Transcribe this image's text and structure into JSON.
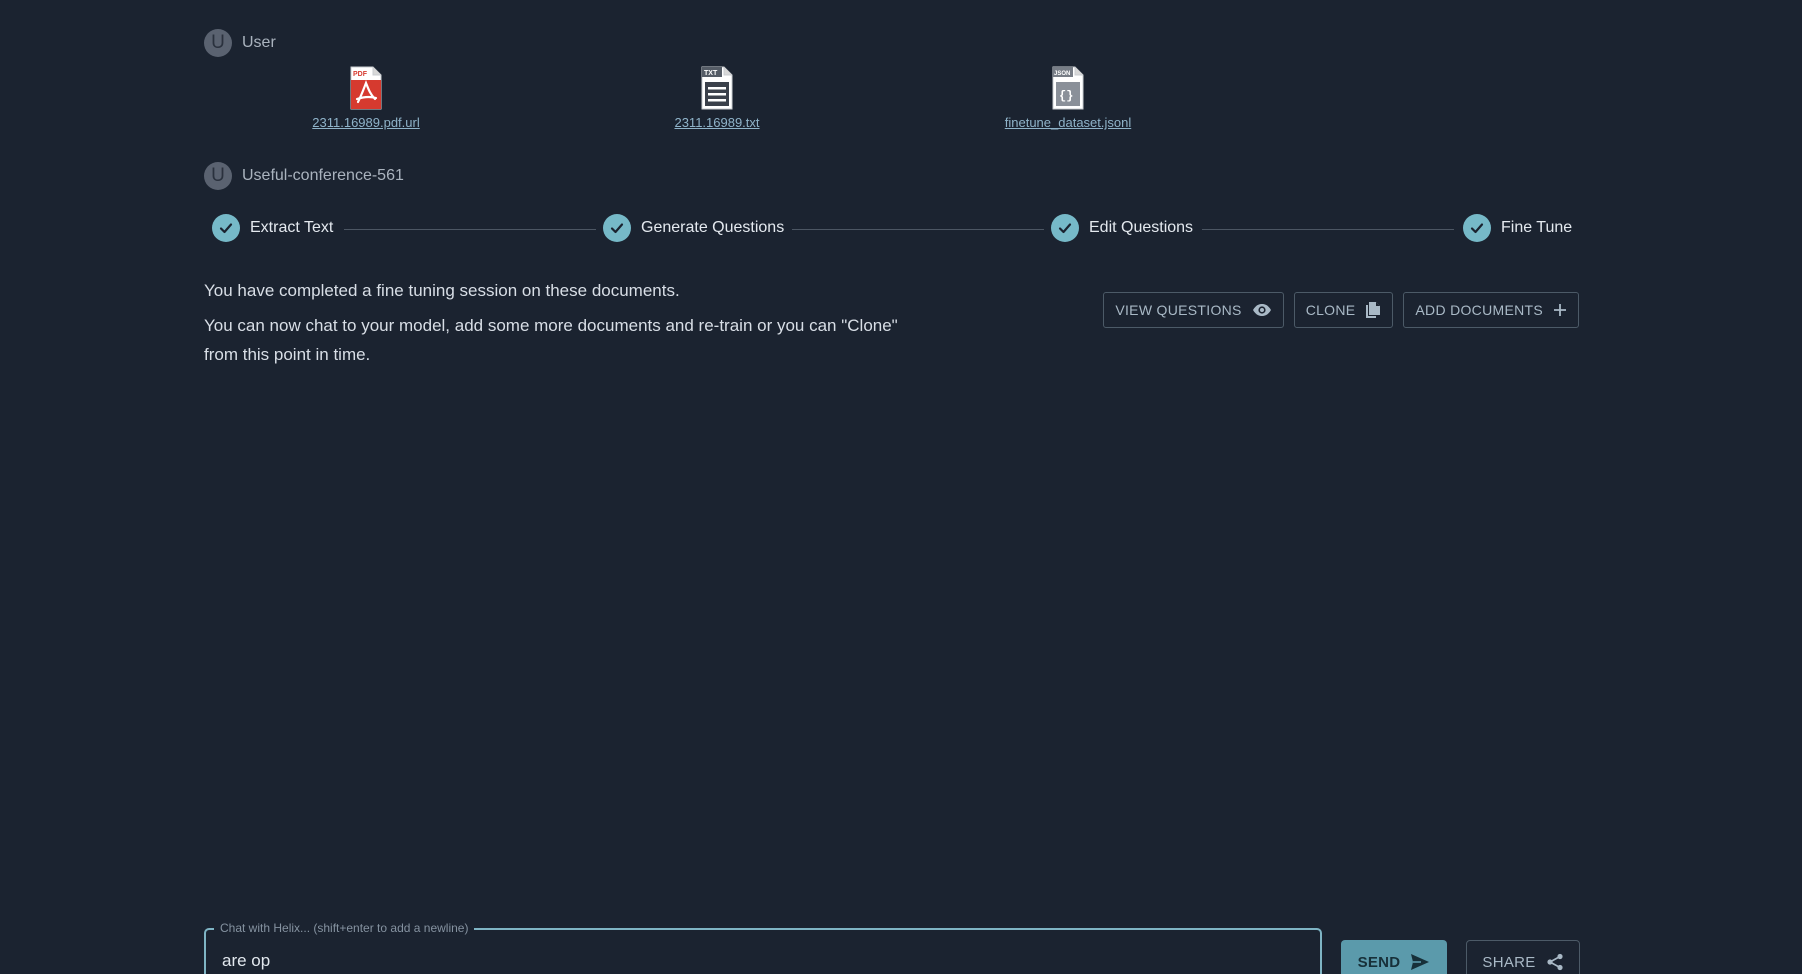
{
  "messages": [
    {
      "avatar_letter": "U",
      "name": "User"
    },
    {
      "avatar_letter": "U",
      "name": "Useful-conference-561"
    }
  ],
  "files": [
    {
      "name": "2311.16989.pdf.url",
      "icon": "pdf-file-icon",
      "badge": "PDF"
    },
    {
      "name": "2311.16989.txt",
      "icon": "txt-file-icon",
      "badge": "TXT"
    },
    {
      "name": "finetune_dataset.jsonl",
      "icon": "json-file-icon",
      "badge": "JSON"
    }
  ],
  "stepper": {
    "steps": [
      {
        "label": "Extract Text",
        "completed": true
      },
      {
        "label": "Generate Questions",
        "completed": true
      },
      {
        "label": "Edit Questions",
        "completed": true
      },
      {
        "label": "Fine Tune",
        "completed": true
      }
    ]
  },
  "status": {
    "line1": "You have completed a fine tuning session on these documents.",
    "line2": "You can now chat to your model, add some more documents and re-train or you can \"Clone\" from this point in time."
  },
  "actions": {
    "view_questions": "VIEW QUESTIONS",
    "clone": "CLONE",
    "add_documents": "ADD DOCUMENTS"
  },
  "chat": {
    "placeholder_label": "Chat with Helix... (shift+enter to add a newline)",
    "value": "are op"
  },
  "buttons": {
    "send": "SEND",
    "share": "SHARE"
  },
  "colors": {
    "background": "#1b2330",
    "accent": "#76b9c8",
    "send_button": "#5b9aab",
    "pdf_red": "#d63a2f"
  }
}
